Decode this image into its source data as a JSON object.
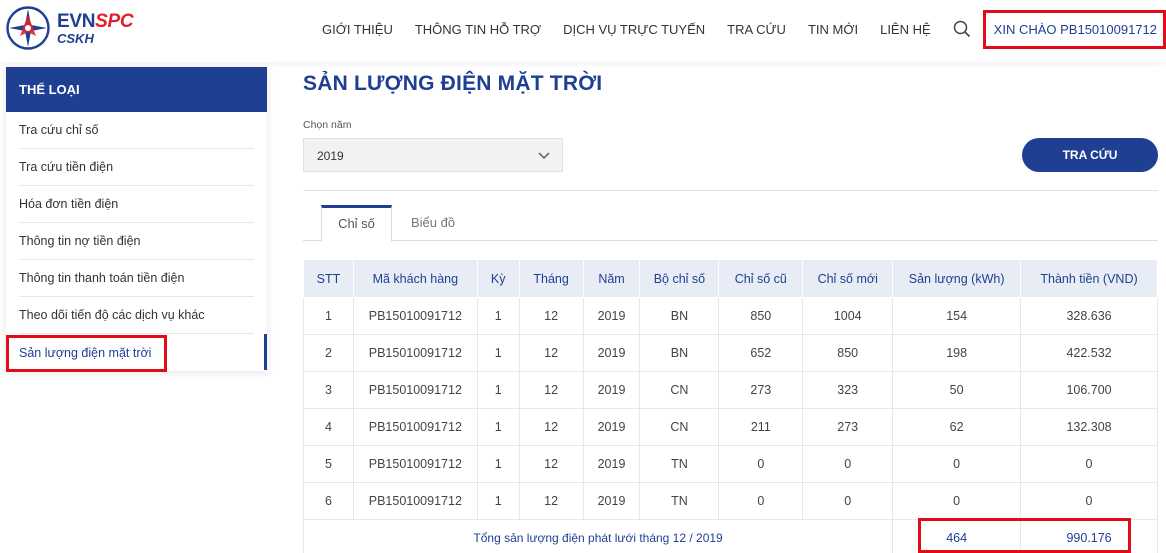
{
  "brand": {
    "evn": "EVN",
    "spc": "SPC",
    "sub": "CSKH",
    "colors": {
      "primary": "#1f3f93",
      "red": "#e2212b",
      "highlight": "#e00d18"
    }
  },
  "nav": {
    "items": [
      "GIỚI THIỆU",
      "THÔNG TIN HỖ TRỢ",
      "DỊCH VỤ TRỰC TUYẾN",
      "TRA CỨU",
      "TIN MỚI",
      "LIÊN HỆ"
    ],
    "search_icon": "search-icon",
    "greeting": "XIN CHÀO PB15010091712"
  },
  "sidebar": {
    "title": "THỂ LOẠI",
    "items": [
      "Tra cứu chỉ số",
      "Tra cứu tiền điện",
      "Hóa đơn tiền điện",
      "Thông tin nợ tiền điện",
      "Thông tin thanh toán tiền điện",
      "Theo dõi tiến độ các dịch vụ khác",
      "Sản lượng điện mặt trời"
    ],
    "active_index": 6
  },
  "main": {
    "title": "SẢN LƯỢNG ĐIỆN MẶT TRỜI",
    "year_label": "Chọn năm",
    "year_value": "2019",
    "search_button": "TRA CỨU",
    "tabs": [
      "Chỉ số",
      "Biểu đồ"
    ],
    "active_tab": 0
  },
  "table": {
    "headers": [
      "STT",
      "Mã khách hàng",
      "Kỳ",
      "Tháng",
      "Năm",
      "Bộ chỉ số",
      "Chỉ số cũ",
      "Chỉ số mới",
      "Sản lượng (kWh)",
      "Thành tiền (VND)"
    ],
    "rows": [
      [
        "1",
        "PB15010091712",
        "1",
        "12",
        "2019",
        "BN",
        "850",
        "1004",
        "154",
        "328.636"
      ],
      [
        "2",
        "PB15010091712",
        "1",
        "12",
        "2019",
        "BN",
        "652",
        "850",
        "198",
        "422.532"
      ],
      [
        "3",
        "PB15010091712",
        "1",
        "12",
        "2019",
        "CN",
        "273",
        "323",
        "50",
        "106.700"
      ],
      [
        "4",
        "PB15010091712",
        "1",
        "12",
        "2019",
        "CN",
        "211",
        "273",
        "62",
        "132.308"
      ],
      [
        "5",
        "PB15010091712",
        "1",
        "12",
        "2019",
        "TN",
        "0",
        "0",
        "0",
        "0"
      ],
      [
        "6",
        "PB15010091712",
        "1",
        "12",
        "2019",
        "TN",
        "0",
        "0",
        "0",
        "0"
      ]
    ],
    "total_label": "Tổng sản lượng điện phát lưới tháng 12 / 2019",
    "total_kwh": "464",
    "total_vnd": "990.176"
  }
}
